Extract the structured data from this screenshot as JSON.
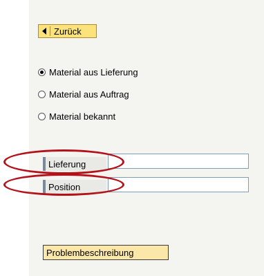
{
  "back_button": {
    "label": "Zurück"
  },
  "radio_options": [
    {
      "label": "Material aus Lieferung",
      "selected": true
    },
    {
      "label": "Material aus Auftrag",
      "selected": false
    },
    {
      "label": "Material bekannt",
      "selected": false
    }
  ],
  "fields": [
    {
      "label": "Lieferung",
      "value": ""
    },
    {
      "label": "Position",
      "value": ""
    }
  ],
  "problem_button": {
    "label": "Problembeschreibung"
  },
  "highlight_color": "#b3121a"
}
